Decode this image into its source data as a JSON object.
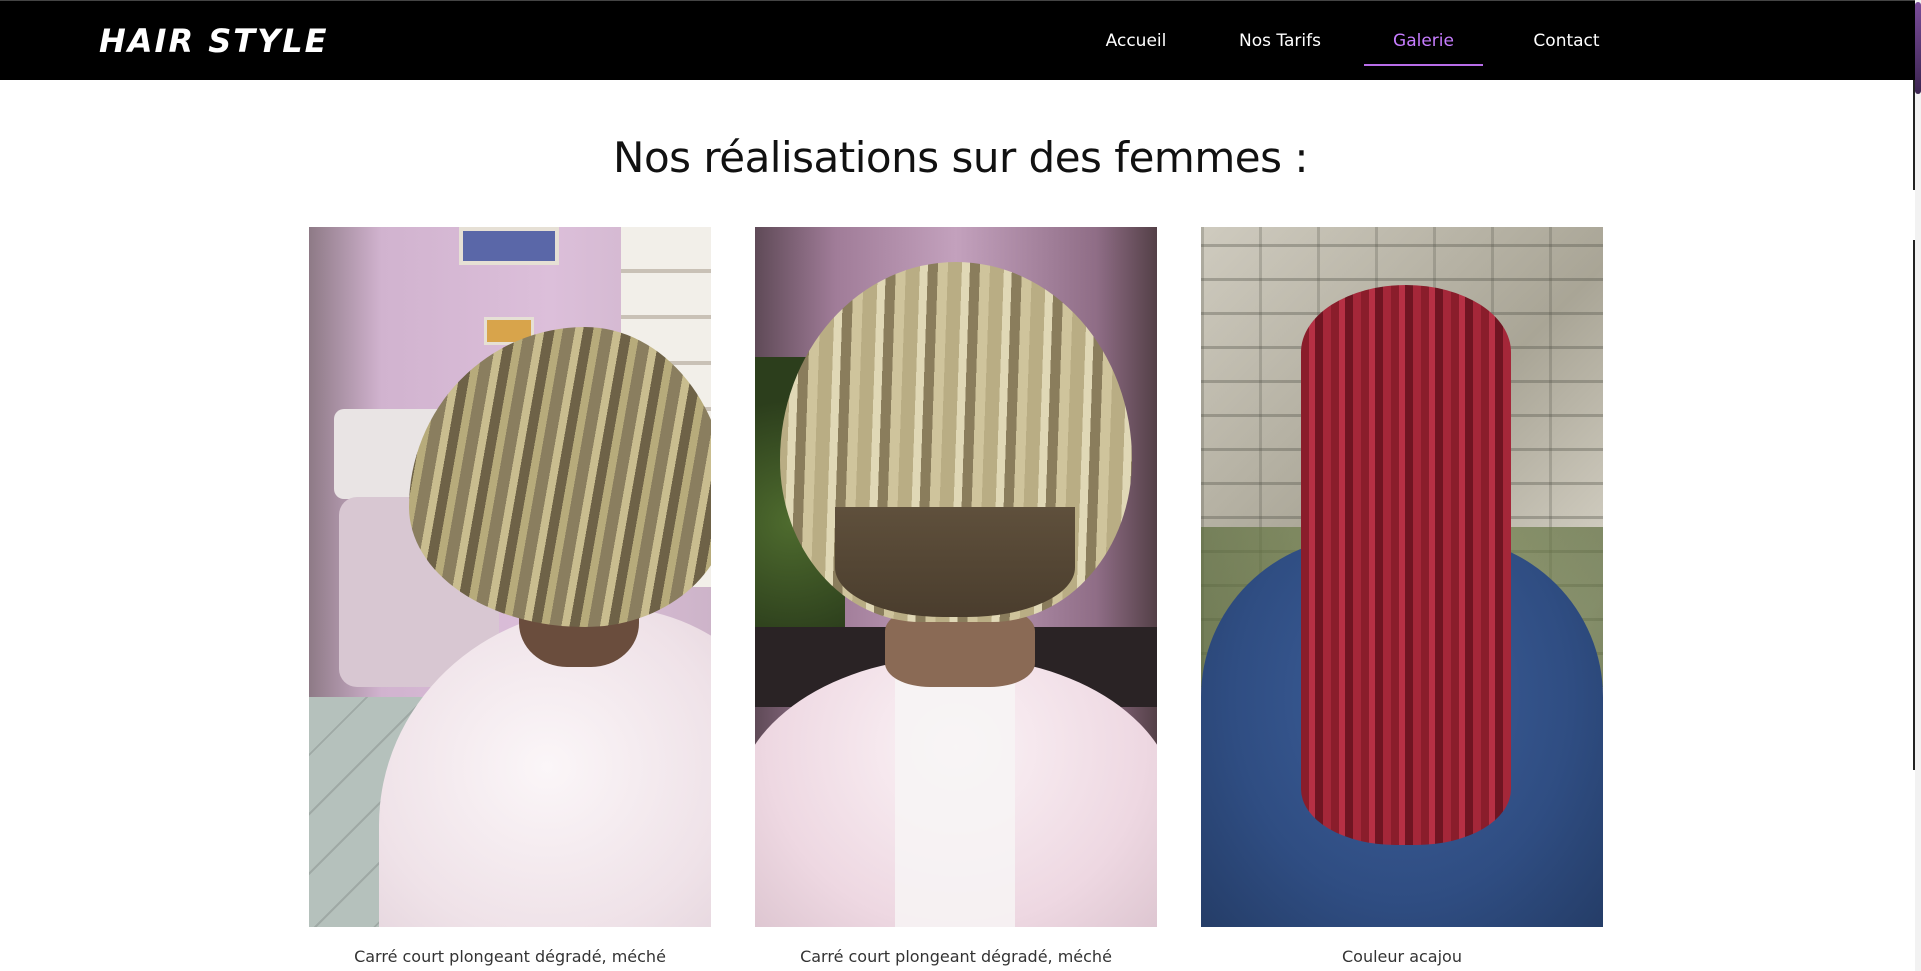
{
  "header": {
    "brand": "HAIR STYLE",
    "nav": [
      {
        "label": "Accueil",
        "active": false
      },
      {
        "label": "Nos Tarifs",
        "active": false
      },
      {
        "label": "Galerie",
        "active": true
      },
      {
        "label": "Contact",
        "active": false
      }
    ]
  },
  "colors": {
    "header_bg": "#000000",
    "active_nav": "#c77dff",
    "page_bg": "#ffffff"
  },
  "main": {
    "title": "Nos réalisations sur des femmes :",
    "gallery": [
      {
        "caption": "Carré court plongeant dégradé, méché"
      },
      {
        "caption": "Carré court plongeant dégradé, méché"
      },
      {
        "caption": "Couleur acajou"
      }
    ]
  }
}
